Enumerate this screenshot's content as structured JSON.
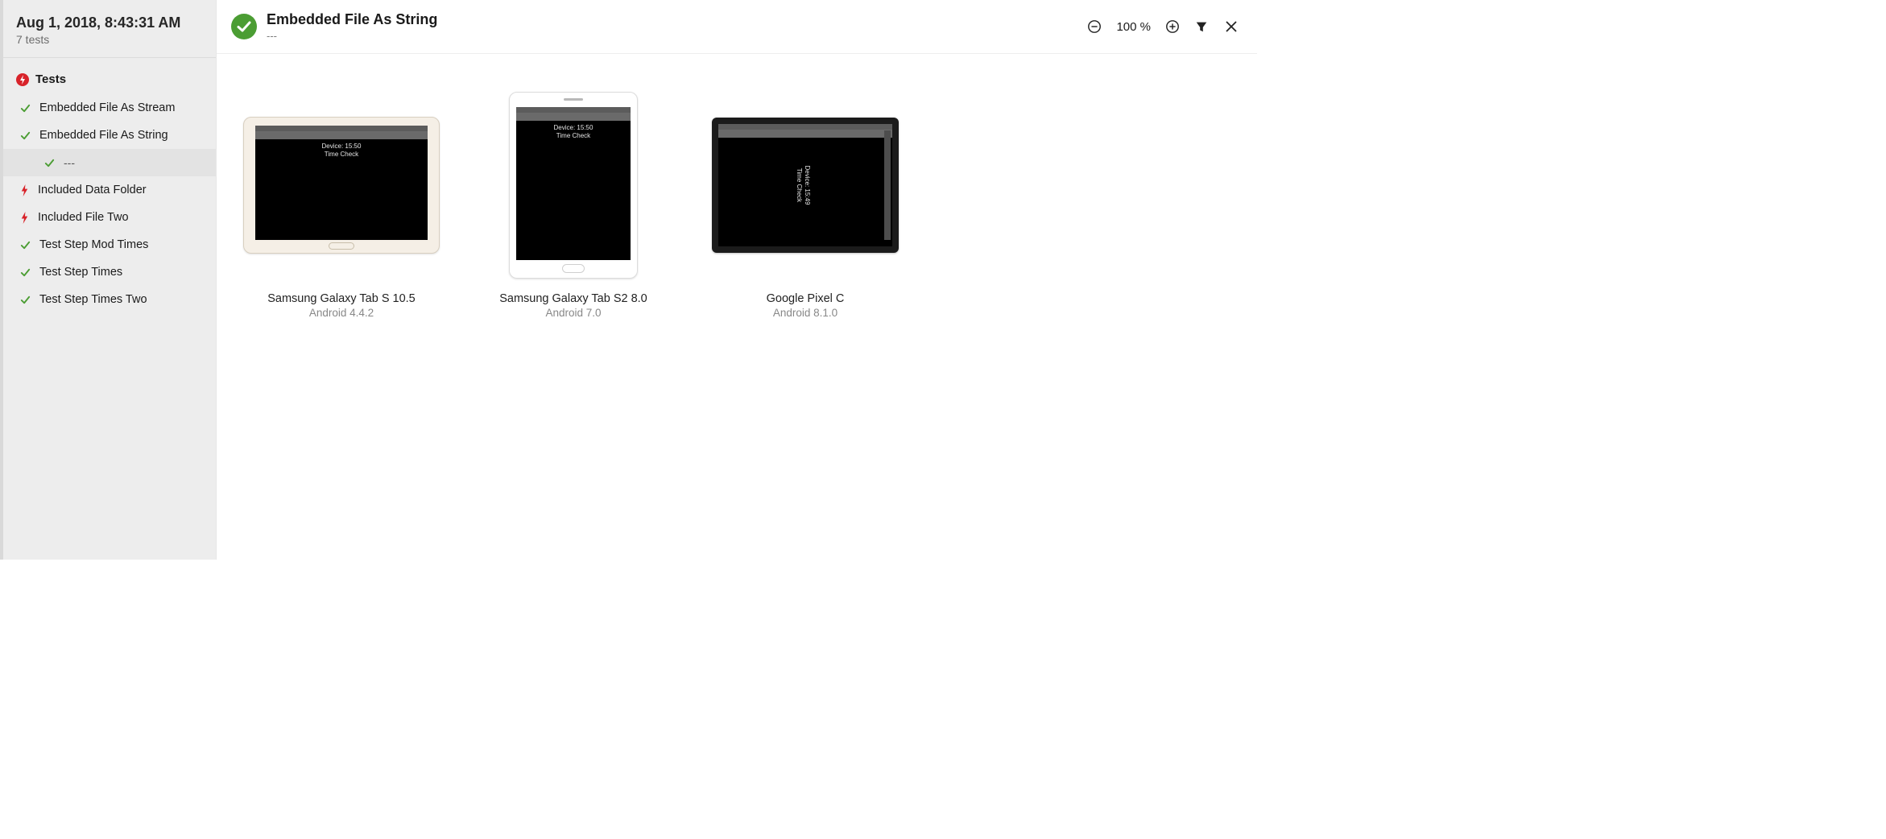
{
  "run": {
    "date_label": "Aug 1, 2018, 8:43:31 AM",
    "count_label": "7 tests"
  },
  "sidebar": {
    "root_label": "Tests",
    "items": [
      {
        "label": "Embedded File As Stream",
        "status": "pass"
      },
      {
        "label": "Embedded File As String",
        "status": "pass",
        "expanded": true,
        "children": [
          {
            "label": "---",
            "status": "pass",
            "selected": true
          }
        ]
      },
      {
        "label": "Included Data Folder",
        "status": "fail"
      },
      {
        "label": "Included File Two",
        "status": "fail"
      },
      {
        "label": "Test Step Mod Times",
        "status": "pass"
      },
      {
        "label": "Test Step Times",
        "status": "pass"
      },
      {
        "label": "Test Step Times Two",
        "status": "pass"
      }
    ]
  },
  "main": {
    "status": "pass",
    "title": "Embedded File As String",
    "subtitle": "---",
    "zoom_label": "100 %",
    "devices": [
      {
        "name": "Samsung Galaxy Tab S 10.5",
        "os": "Android 4.4.2",
        "frame": "tablet-landscape-silver",
        "screen": {
          "line1": "Device: 15:50",
          "line2": "Time Check",
          "orientation": "normal"
        }
      },
      {
        "name": "Samsung Galaxy Tab S2 8.0",
        "os": "Android 7.0",
        "frame": "tablet-portrait-white",
        "screen": {
          "line1": "Device: 15:50",
          "line2": "Time Check",
          "orientation": "normal"
        }
      },
      {
        "name": "Google Pixel C",
        "os": "Android 8.1.0",
        "frame": "tablet-landscape-black",
        "screen": {
          "line1": "Device: 15:49",
          "line2": "Time Check",
          "orientation": "rotated"
        }
      }
    ]
  }
}
